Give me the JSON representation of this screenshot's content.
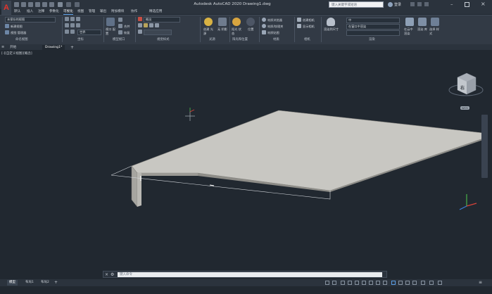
{
  "title_bar": {
    "window_title": "Autodesk AutoCAD 2020    Drawing1.dwg",
    "search_placeholder": "键入关键字或短语",
    "login_label": "登录"
  },
  "app_logo": "A",
  "menu": [
    {
      "label": "默认"
    },
    {
      "label": "插入"
    },
    {
      "label": "注释"
    },
    {
      "label": "参数化"
    },
    {
      "label": "可视化",
      "active": true
    },
    {
      "label": "视图"
    },
    {
      "label": "管理"
    },
    {
      "label": "输出"
    },
    {
      "label": "附加模块"
    },
    {
      "label": "协作"
    },
    {
      "label": "精选应用"
    }
  ],
  "ribbon": {
    "panels": [
      {
        "title": "命名视图"
      },
      {
        "title": "坐标"
      },
      {
        "title": "模型视口"
      },
      {
        "title": "视觉样式"
      },
      {
        "title": "光源"
      },
      {
        "title": "阳光和位置"
      },
      {
        "title": "材质"
      },
      {
        "title": "相机"
      },
      {
        "title": "渲染"
      }
    ],
    "named_views": {
      "dropdown": "未保存的视图",
      "new_view": "新建视图",
      "view_manager": "视图 管理器"
    },
    "coordinates": {
      "ucs_dropdown": "世界"
    },
    "model_viewports": {
      "button": "视口 配置",
      "join": "合并",
      "restore": "恢复"
    },
    "visual_styles": {
      "dropdown": "概念"
    },
    "lights": {
      "create": "创建 光源",
      "none": "无 阴影"
    },
    "sun_location": {
      "sun_status": "阳光 状态",
      "location": "位置"
    },
    "materials": {
      "browser": "材质浏览器",
      "mapping": "材质贴图",
      "textures": "材质/纹理关"
    },
    "camera": {
      "create": "创建相机",
      "show": "显示相机"
    },
    "render": {
      "render_size": "渲染到尺寸",
      "quality_dropdown": "中",
      "target_dropdown": "在窗口中渲染",
      "cloud": "在云中 渲染",
      "gallery": "渲染 库",
      "env": "渲染 环境"
    },
    "select_style": "选择 样式"
  },
  "file_tabs": [
    {
      "label": "开始"
    },
    {
      "label": "Drawing1*",
      "active": true
    }
  ],
  "viewport": {
    "label": "[-][自定义视图][概念]",
    "viewcube_face": "右",
    "wcs_label": "WCS"
  },
  "command_line": {
    "placeholder": "键入命令"
  },
  "layout_tabs": [
    {
      "label": "模型",
      "active": true
    },
    {
      "label": "布局1"
    },
    {
      "label": "布局2"
    }
  ],
  "colors": {
    "background": "#212830",
    "ribbon": "#323a45",
    "slab_top": "#c8c7c2",
    "slab_edge": "#9b9a95",
    "accent": "#5a9ee6",
    "logo": "#e5332a"
  }
}
